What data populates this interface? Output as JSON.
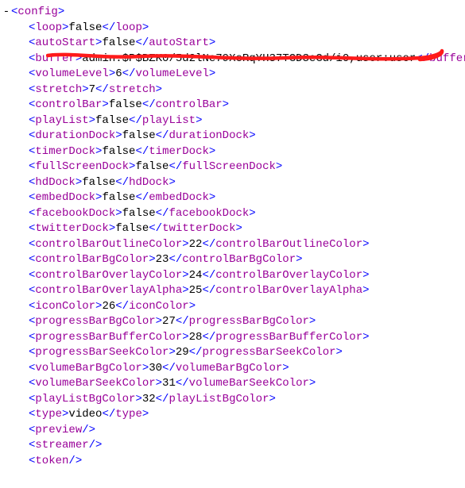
{
  "root_tag": "config",
  "buffer_value": "admin:$P$BZK0/5d2lNe79XeRqYH37TGD3eGd/i0,user:user",
  "elements": [
    {
      "tag": "loop",
      "value": "false"
    },
    {
      "tag": "autoStart",
      "value": "false"
    },
    {
      "tag": "buffer",
      "value": "admin:$P$BZK0/5d2lNe79XeRqYH37TGD3eGd/i0,user:user"
    },
    {
      "tag": "volumeLevel",
      "value": "6"
    },
    {
      "tag": "stretch",
      "value": "7"
    },
    {
      "tag": "controlBar",
      "value": "false"
    },
    {
      "tag": "playList",
      "value": "false"
    },
    {
      "tag": "durationDock",
      "value": "false"
    },
    {
      "tag": "timerDock",
      "value": "false"
    },
    {
      "tag": "fullScreenDock",
      "value": "false"
    },
    {
      "tag": "hdDock",
      "value": "false"
    },
    {
      "tag": "embedDock",
      "value": "false"
    },
    {
      "tag": "facebookDock",
      "value": "false"
    },
    {
      "tag": "twitterDock",
      "value": "false"
    },
    {
      "tag": "controlBarOutlineColor",
      "value": "22"
    },
    {
      "tag": "controlBarBgColor",
      "value": "23"
    },
    {
      "tag": "controlBarOverlayColor",
      "value": "24"
    },
    {
      "tag": "controlBarOverlayAlpha",
      "value": "25"
    },
    {
      "tag": "iconColor",
      "value": "26"
    },
    {
      "tag": "progressBarBgColor",
      "value": "27"
    },
    {
      "tag": "progressBarBufferColor",
      "value": "28"
    },
    {
      "tag": "progressBarSeekColor",
      "value": "29"
    },
    {
      "tag": "volumeBarBgColor",
      "value": "30"
    },
    {
      "tag": "volumeBarSeekColor",
      "value": "31"
    },
    {
      "tag": "playListBgColor",
      "value": "32"
    },
    {
      "tag": "type",
      "value": "video"
    }
  ],
  "self_closing": [
    "preview",
    "streamer",
    "token"
  ],
  "toggle_glyph": "-",
  "underline_color": "#ff1a1a"
}
